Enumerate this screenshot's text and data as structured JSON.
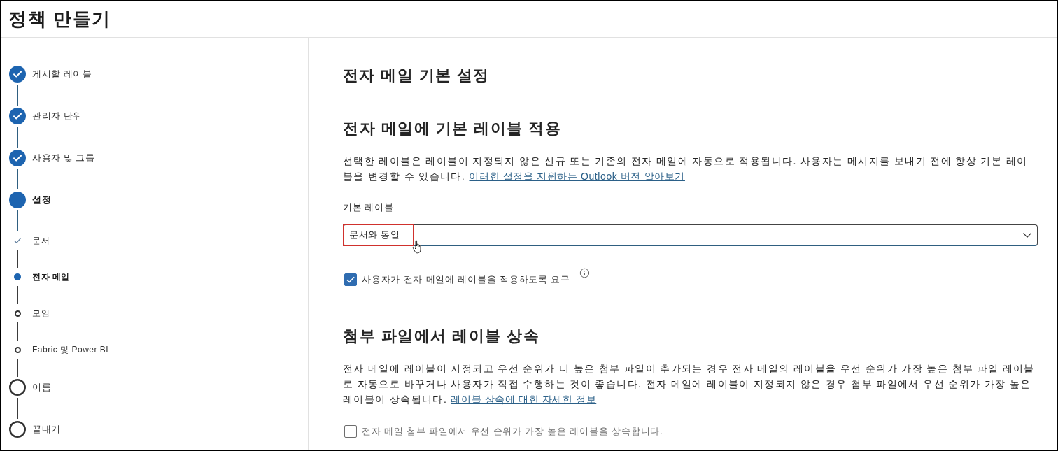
{
  "header": {
    "title": "정책 만들기"
  },
  "steps": [
    {
      "label": "게시할 레이블",
      "completed": true,
      "selected": false
    },
    {
      "label": "관리자 단위",
      "completed": true,
      "selected": false
    },
    {
      "label": "사용자 및 그룹",
      "completed": true,
      "selected": false
    },
    {
      "label": "설정",
      "completed": false,
      "selected": true,
      "children": [
        {
          "label": "문서",
          "completed": true,
          "selected": false
        },
        {
          "label": "전자 메일",
          "completed": false,
          "selected": true
        },
        {
          "label": "모임",
          "completed": false,
          "selected": false
        },
        {
          "label": "Fabric 및 Power BI",
          "completed": false,
          "selected": false
        }
      ]
    },
    {
      "label": "이름",
      "completed": false,
      "selected": false
    },
    {
      "label": "끝내기",
      "completed": false,
      "selected": false
    }
  ],
  "content": {
    "title": "전자 메일 기본 설정",
    "sections": [
      {
        "heading": "전자 메일에 기본 레이블 적용",
        "description": {
          "text": "선택한 레이블은 레이블이 지정되지 않은 신규 또는 기존의 전자 메일에 자동으로 적용됩니다. 사용자는 메시지를 보내기 전에 항상 기본 레이블을 변경할 수 있습니다.",
          "link": "이러한 설정을 지원하는 Outlook 버전 알아보기"
        },
        "field": {
          "label": "기본 레이블",
          "value": "문서와 동일",
          "highlighted": true
        },
        "checkbox": {
          "label": "사용자가 전자 메일에 레이블을 적용하도록 요구",
          "checked": true,
          "disabled": false,
          "info": true
        }
      },
      {
        "heading": "첨부 파일에서 레이블 상속",
        "description": {
          "text": "전자 메일에 레이블이 지정되고 우선 순위가 더 높은 첨부 파일이 추가되는 경우 전자 메일의 레이블을 우선 순위가 가장 높은 첨부 파일 레이블로 자동으로 바꾸거나 사용자가 직접 수행하는 것이 좋습니다. 전자 메일에 레이블이 지정되지 않은 경우 첨부 파일에서 우선 순위가 가장 높은 레이블이 상속됩니다.",
          "link": "레이블 상속에 대한 자세한 정보"
        },
        "checkbox": {
          "label": "전자 메일 첨부 파일에서 우선 순위가 가장 높은 레이블을 상속합니다.",
          "checked": false,
          "disabled": true
        }
      }
    ]
  }
}
